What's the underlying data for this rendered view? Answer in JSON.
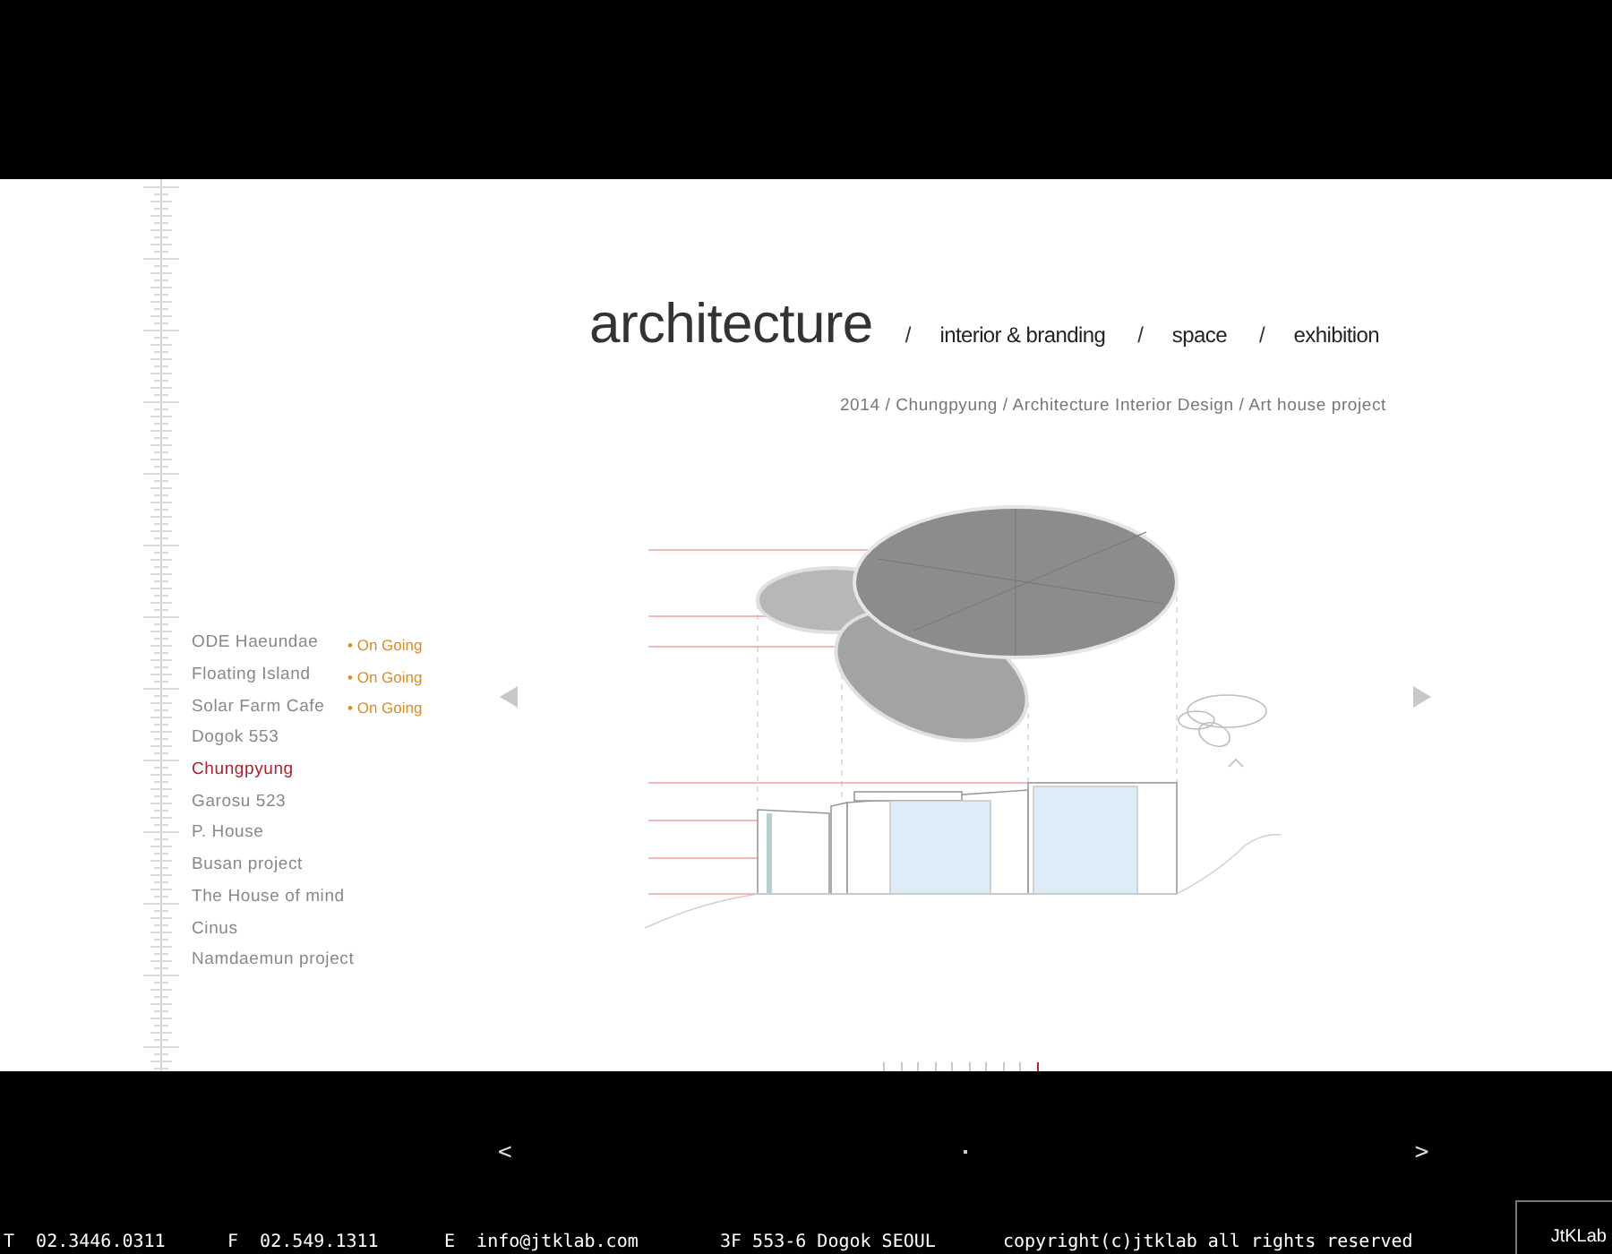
{
  "header": {
    "title": "architecture",
    "nav": [
      {
        "separator": "/",
        "label": "interior & branding"
      },
      {
        "separator": "/",
        "label": "space"
      },
      {
        "separator": "/",
        "label": "exhibition"
      }
    ]
  },
  "caption": "2014 / Chungpyung / Architecture Interior Design / Art house project",
  "projects": [
    {
      "name": "ODE Haeundae",
      "status": "• On Going",
      "selected": false
    },
    {
      "name": "Floating Island",
      "status": "• On Going",
      "selected": false
    },
    {
      "name": "Solar Farm Cafe",
      "status": "• On Going",
      "selected": false
    },
    {
      "name": "Dogok 553",
      "selected": false
    },
    {
      "name": "Chungpyung",
      "selected": true
    },
    {
      "name": "Garosu 523",
      "selected": false
    },
    {
      "name": "P. House",
      "selected": false
    },
    {
      "name": "Busan project",
      "selected": false
    },
    {
      "name": "The House of mind",
      "selected": false
    },
    {
      "name": "Cinus",
      "selected": false
    },
    {
      "name": "Namdaemun project",
      "selected": false
    }
  ],
  "timeline": [
    {
      "selected": false
    },
    {
      "selected": false
    },
    {
      "selected": false
    },
    {
      "selected": false
    },
    {
      "selected": false
    },
    {
      "selected": false
    },
    {
      "selected": false
    },
    {
      "selected": false
    },
    {
      "selected": false
    },
    {
      "selected": true
    }
  ],
  "pager": {
    "prev": "<",
    "next": ">"
  },
  "footer": [
    {
      "label": "T",
      "value": "02.3446.0311"
    },
    {
      "label": "F",
      "value": "02.549.1311"
    },
    {
      "label": "E",
      "value": "info@jtklab.com"
    },
    {
      "value": "3F 553-6 Dogok SEOUL"
    },
    {
      "value": "copyright(c)jtklab all rights reserved"
    }
  ],
  "logo": "JtKLab"
}
